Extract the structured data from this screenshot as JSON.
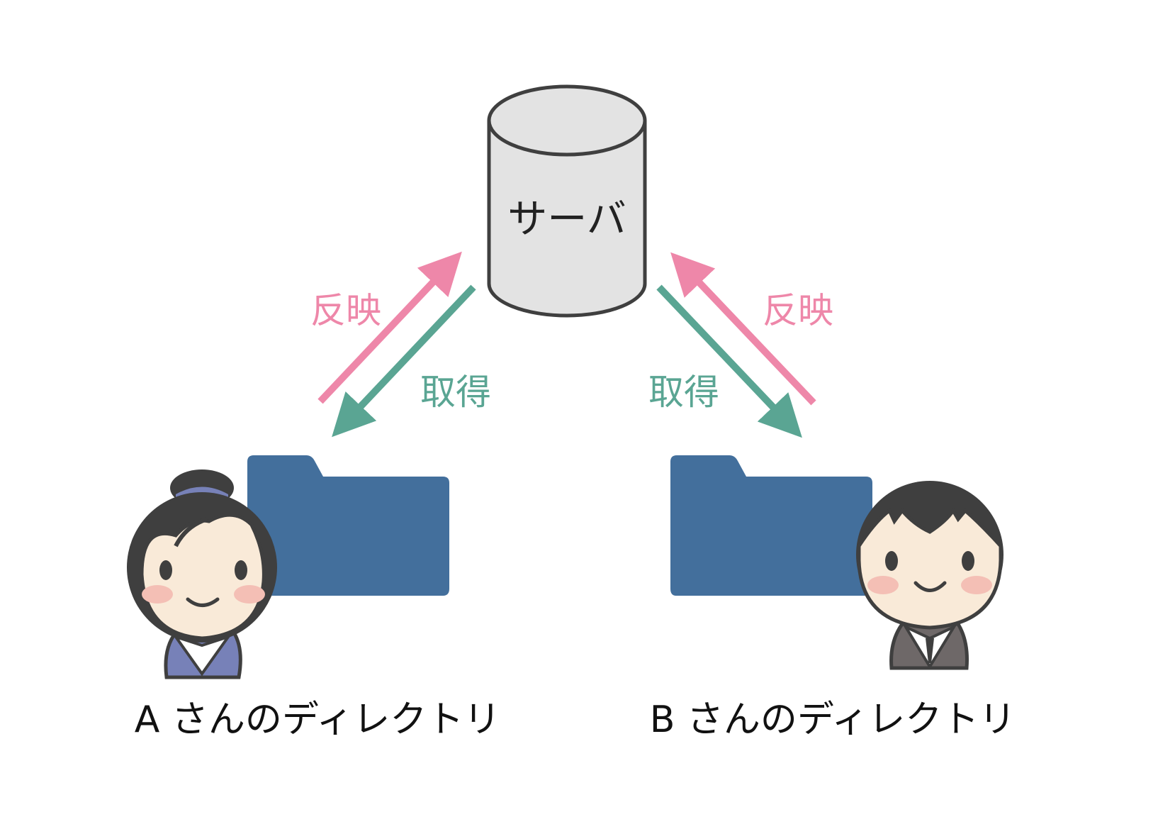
{
  "server": {
    "label": "サーバ"
  },
  "arrows": {
    "left_reflect": "反映",
    "left_fetch": "取得",
    "right_reflect": "反映",
    "right_fetch": "取得"
  },
  "users": {
    "a": {
      "caption": "A さんのディレクトリ"
    },
    "b": {
      "caption": "B さんのディレクトリ"
    }
  },
  "colors": {
    "reflect": "#ee87a9",
    "fetch": "#5aa593",
    "folder": "#436f9c",
    "server_fill": "#e3e3e3",
    "outline": "#3f3f3f",
    "skin": "#f9ead8",
    "cheek": "#f4bfb5",
    "a_clothes": "#7781b8",
    "b_clothes": "#6e6868"
  }
}
